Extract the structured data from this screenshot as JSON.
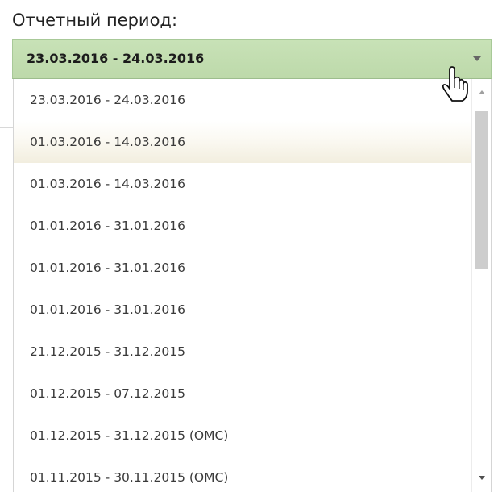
{
  "field": {
    "label": "Отчетный период:",
    "selected_value": "23.03.2016 - 24.03.2016"
  },
  "dropdown": {
    "options": [
      "23.03.2016 - 24.03.2016",
      "01.03.2016 - 14.03.2016",
      "01.03.2016 - 14.03.2016",
      "01.01.2016 - 31.01.2016",
      "01.01.2016 - 31.01.2016",
      "01.01.2016 - 31.01.2016",
      "21.12.2015 - 31.12.2015",
      "01.12.2015 - 07.12.2015",
      "01.12.2015 - 31.12.2015 (ОМС)",
      "01.11.2015 - 30.11.2015 (ОМС)"
    ],
    "hovered_index": 1
  },
  "colors": {
    "combo_background": "#c3dcb1",
    "hover_background": "#f6f2e6",
    "text": "#3a3a3a"
  },
  "icons": {
    "combo_arrow": "chevron-down-icon",
    "cursor": "hand-pointer-icon"
  }
}
